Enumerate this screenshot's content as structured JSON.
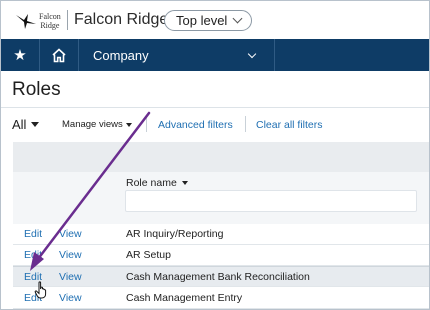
{
  "logo": {
    "line1": "Falcon",
    "line2": "Ridge"
  },
  "company": {
    "name": "Falcon Ridge"
  },
  "entity_selector": {
    "label": "Top level"
  },
  "nav": {
    "company_label": "Company"
  },
  "page": {
    "title": "Roles"
  },
  "filters": {
    "view_label": "All",
    "manage_views": "Manage views",
    "advanced": "Advanced filters",
    "clear": "Clear all filters"
  },
  "grid": {
    "column_header": "Role name",
    "rows": [
      {
        "edit": "Edit",
        "view": "View",
        "name": "AR Inquiry/Reporting"
      },
      {
        "edit": "Edit",
        "view": "View",
        "name": "AR Setup"
      },
      {
        "edit": "Edit",
        "view": "View",
        "name": "Cash Management Bank Reconciliation"
      },
      {
        "edit": "Edit",
        "view": "View",
        "name": "Cash Management Entry"
      }
    ]
  },
  "colors": {
    "nav_bg": "#0e3c66",
    "link": "#1f6fb2",
    "annotation_arrow": "#6a2d8f"
  }
}
